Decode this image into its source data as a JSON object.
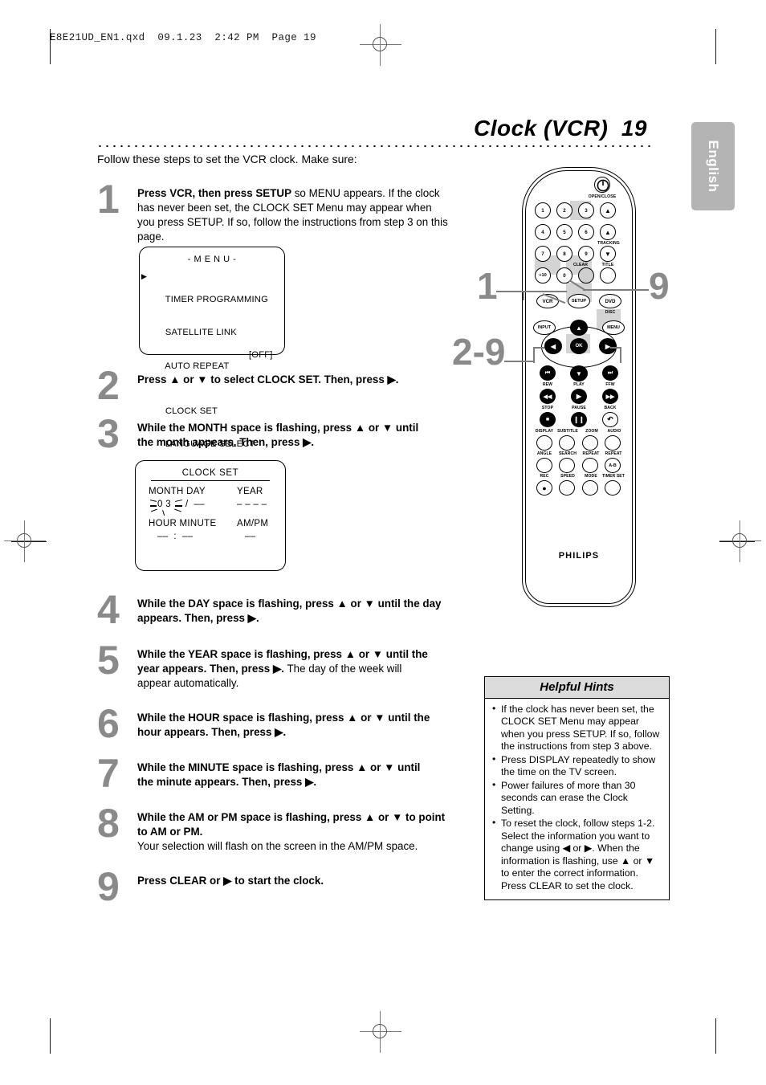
{
  "page": {
    "slug": "E8E21UD_EN1.qxd  09.1.23  2:42 PM  Page 19",
    "title": "Clock (VCR)  19",
    "language_tab": "English",
    "intro": "Follow these steps to set the VCR clock. Make sure:"
  },
  "steps": [
    {
      "num": "1",
      "html": "<b>Press VCR, then press SETUP</b> so MENU appears. If the clock has never been set, the CLOCK SET Menu may appear when you press SETUP. If so, follow the instructions from step 3 on this page."
    },
    {
      "num": "2",
      "html": "<b>Press ▲ or ▼ to select CLOCK SET. Then, press ▶.</b>"
    },
    {
      "num": "3",
      "html": "<b>While the MONTH space is flashing, press ▲ or ▼ until the month appears. Then, press ▶.</b>"
    },
    {
      "num": "4",
      "html": "<b>While the DAY space is flashing, press ▲ or ▼ until the day appears. Then, press ▶.</b>"
    },
    {
      "num": "5",
      "html": "<b>While the YEAR space is flashing, press ▲ or ▼ until the year appears. Then, press ▶.</b> The day of the week will appear automatically."
    },
    {
      "num": "6",
      "html": "<b>While the HOUR space is flashing, press ▲ or ▼ until the hour appears. Then, press ▶.</b>"
    },
    {
      "num": "7",
      "html": "<b>While the MINUTE space is flashing, press ▲ or ▼ until the minute appears. Then, press ▶.</b>"
    },
    {
      "num": "8",
      "html": "<b>While the AM or PM space is flashing, press ▲ or ▼ to point to AM or PM.</b><br>Your selection will flash on the screen in the AM/PM space."
    },
    {
      "num": "9",
      "html": "<b>Press CLEAR or ▶ to start the clock.</b>"
    }
  ],
  "osd_menu": {
    "title": "- M E N U -",
    "items": [
      {
        "label": "TIMER PROGRAMMING",
        "pointer": "▶",
        "value": ""
      },
      {
        "label": "SATELLITE LINK",
        "pointer": "",
        "value": ""
      },
      {
        "label": "AUTO REPEAT",
        "pointer": "",
        "value": "[OFF]"
      },
      {
        "label": "CLOCK SET",
        "pointer": "",
        "value": ""
      },
      {
        "label": "LANGUAGE SELECT",
        "pointer": "",
        "value": ""
      }
    ]
  },
  "osd_clock": {
    "title": "CLOCK SET",
    "label_month_day": "MONTH DAY",
    "label_year": "YEAR",
    "label_hour_minute": "HOUR MINUTE",
    "label_ampm": "AM/PM",
    "value_month": "0 3",
    "value_day_sep": "/  ––",
    "value_year": "– – – –",
    "value_hour_minute": "––  :  ––",
    "value_ampm": "––"
  },
  "remote": {
    "brand": "PHILIPS",
    "power_label": "OPEN/CLOSE",
    "keypad": [
      "1",
      "2",
      "3",
      "4",
      "5",
      "6",
      "7",
      "8",
      "9",
      "+10",
      "0"
    ],
    "side_labels": {
      "tracking": "TRACKING",
      "clear": "CLEAR",
      "title": "TITLE",
      "disc": "DISC"
    },
    "mode_buttons": [
      "VCR",
      "SETUP",
      "DVD"
    ],
    "nav_buttons": [
      "INPUT",
      "MENU",
      "OK"
    ],
    "transport_labels_row1": [
      "REW",
      "PLAY",
      "FFW"
    ],
    "transport_labels_row2": [
      "STOP",
      "PAUSE",
      "BACK"
    ],
    "func_labels_row1": [
      "DISPLAY",
      "SUBTITLE",
      "ZOOM",
      "AUDIO"
    ],
    "func_labels_row2": [
      "ANGLE",
      "SEARCH",
      "REPEAT",
      "REPEAT"
    ],
    "func_labels_row3": [
      "REC",
      "SPEED",
      "MODE",
      "TIMER SET"
    ],
    "ab_label": "A-B"
  },
  "callouts": {
    "one": "1",
    "nine": "9",
    "two_nine": "2-9"
  },
  "hints": {
    "title": "Helpful Hints",
    "items": [
      "If the clock has never been set, the CLOCK SET Menu may appear when you press SETUP. If so, follow the instructions from step 3 above.",
      "Press DISPLAY repeatedly to show the time on the TV screen.",
      "Power failures of more than 30 seconds can erase the Clock Setting.",
      "To reset the clock, follow steps 1-2. Select the information you want to change using ◀ or ▶. When the information is flashing, use ▲ or ▼ to enter the correct information. Press CLEAR to set the clock."
    ]
  },
  "colors": {
    "step_number": "#8a8a8a",
    "hint_header": "#dcdcdc",
    "lang_tab": "#b4b4b4",
    "highlight": "#d4d4d4"
  }
}
